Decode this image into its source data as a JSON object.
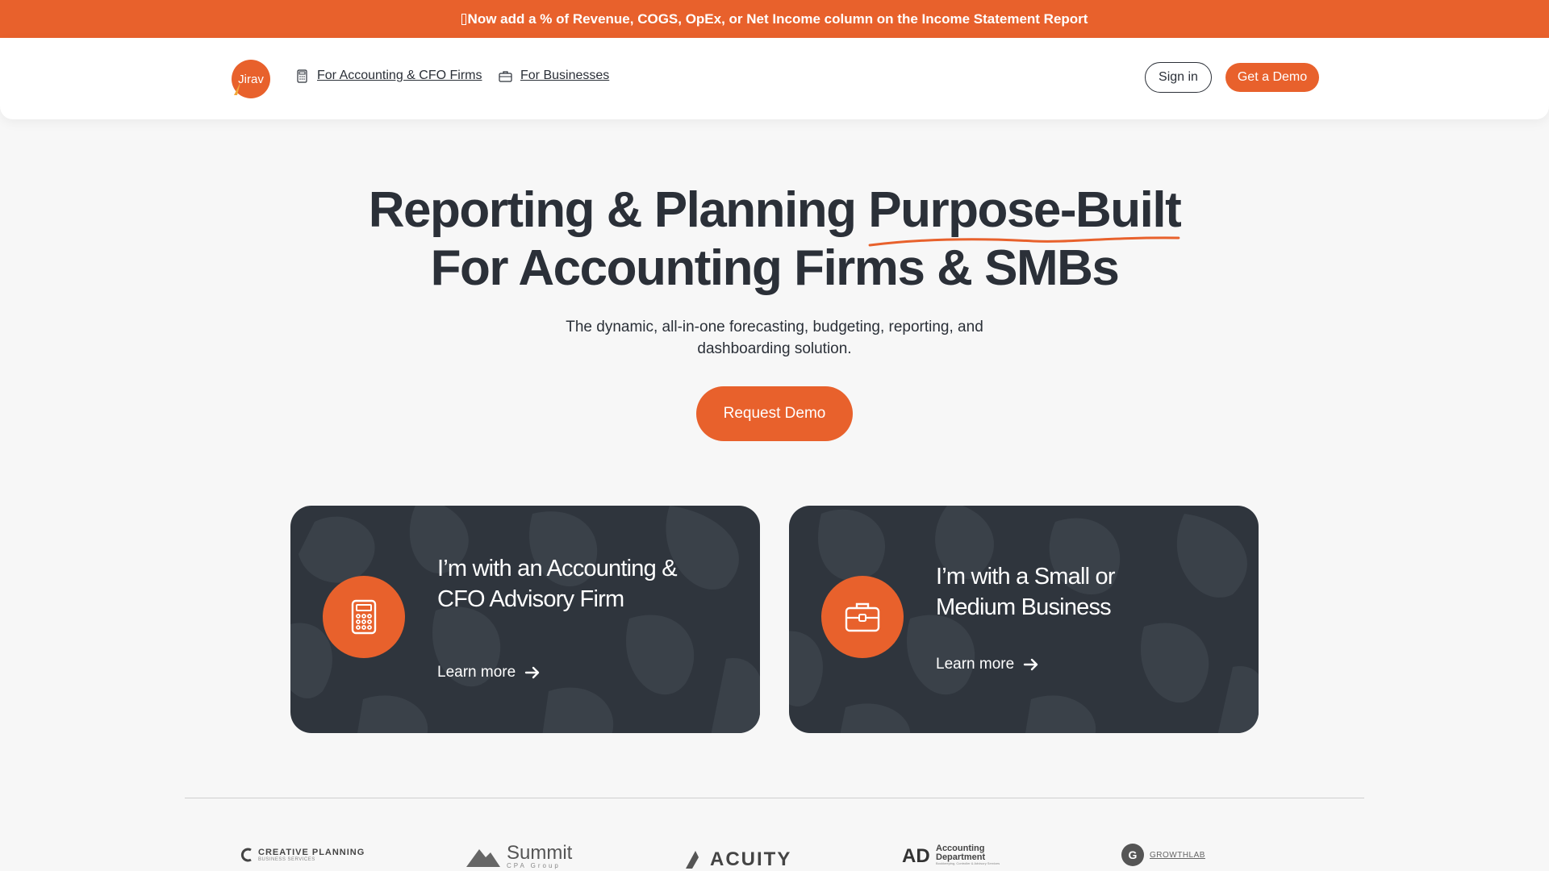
{
  "banner": {
    "text": "Now add a % of Revenue, COGS, OpEx, or Net Income column on the Income Statement Report"
  },
  "header": {
    "logo_text": "Jirav",
    "nav": [
      {
        "label": "For Accounting & CFO Firms",
        "icon": "calculator-icon"
      },
      {
        "label": "For Businesses",
        "icon": "briefcase-icon"
      }
    ],
    "signin_label": "Sign in",
    "demo_label": "Get a Demo"
  },
  "hero": {
    "title_line1_a": "Reporting & Planning",
    "title_line1_b": "Purpose-Built",
    "title_line2_a": "For",
    "title_line2_b": "Accounting Firms & SMBs",
    "subtitle": "The dynamic, all-in-one forecasting, budgeting, reporting, and dashboarding solution.",
    "cta_label": "Request Demo"
  },
  "cards": [
    {
      "title": "I’m with an Accounting & CFO Advisory Firm",
      "link": "Learn more",
      "icon": "calculator-icon"
    },
    {
      "title": "I’m with a Small or Medium Business",
      "link": "Learn more",
      "icon": "briefcase-icon"
    }
  ],
  "clients": [
    {
      "name": "CREATIVE PLANNING",
      "sub": "BUSINESS SERVICES"
    },
    {
      "name": "Summit",
      "sub": "CPA Group"
    },
    {
      "name": "ACUITY",
      "sub": ""
    },
    {
      "name": "Accounting Department",
      "sub": "Bookkeeping, Controller & Advisory Services"
    },
    {
      "name": "GROWTHLAB",
      "sub": ""
    }
  ],
  "colors": {
    "accent": "#e8612c",
    "dark": "#2b3038",
    "card_bg": "#2f353d",
    "page_bg": "#f7f7f7"
  }
}
